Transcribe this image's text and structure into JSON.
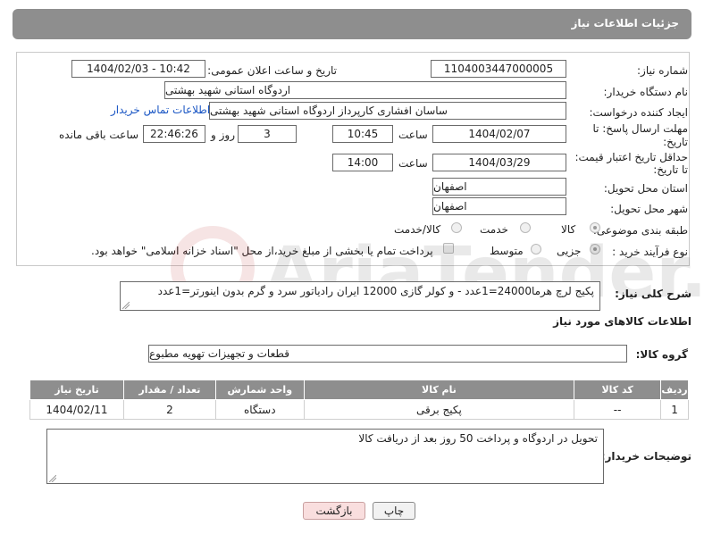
{
  "header": {
    "title": "جزئیات اطلاعات نیاز"
  },
  "form": {
    "need_number": {
      "label": "شماره نیاز:",
      "value": "1104003447000005"
    },
    "announce": {
      "label": "تاریخ و ساعت اعلان عمومی:",
      "value": "1404/02/03 - 10:42"
    },
    "buyer": {
      "label": "نام دستگاه خریدار:",
      "value": "اردوگاه استانی شهید بهشتی"
    },
    "creator": {
      "label": "ایجاد کننده درخواست:",
      "value": "ساسان  افشاری کارپرداز اردوگاه استانی شهید بهشتی",
      "contact_link": "اطلاعات تماس خریدار"
    },
    "deadline": {
      "label_line1": "مهلت ارسال پاسخ: تا",
      "label_line2": "تاریخ:",
      "date": "1404/02/07",
      "time_label": "ساعت",
      "time": "10:45",
      "days": "3",
      "days_label": "روز و",
      "remaining": "22:46:26",
      "remaining_label": "ساعت باقی مانده"
    },
    "price_validity": {
      "label_line1": "حداقل تاریخ اعتبار قیمت:",
      "label_line2": "تا تاریخ:",
      "date": "1404/03/29",
      "time_label": "ساعت",
      "time": "14:00"
    },
    "province": {
      "label": "استان محل تحویل:",
      "value": "اصفهان"
    },
    "city": {
      "label": "شهر محل تحویل:",
      "value": "اصفهان"
    },
    "category": {
      "label": "طبقه بندی موضوعی:",
      "options": [
        "کالا",
        "خدمت",
        "کالا/خدمت"
      ],
      "selected": "کالا"
    },
    "purchase_type": {
      "label": "نوع فرآیند خرید :",
      "options": [
        "جزیی",
        "متوسط"
      ],
      "selected": "جزیی",
      "payment_note": "پرداخت تمام یا بخشی از مبلغ خرید،از محل \"اسناد خزانه اسلامی\" خواهد بود."
    }
  },
  "summary": {
    "label": "شرح کلی نیاز:",
    "value": "پکیج لرچ هرما24000=1عدد - و کولر گازی 12000 ایران رادیاتور سرد و گرم بدون اینورتر=1عدد"
  },
  "goods_section": {
    "title": "اطلاعات کالاهای مورد نیاز"
  },
  "goods_group": {
    "label": "گروه کالا:",
    "value": "قطعات و تجهیزات تهویه مطبوع"
  },
  "table": {
    "headers": [
      "ردیف",
      "کد کالا",
      "نام کالا",
      "واحد شمارش",
      "تعداد / مقدار",
      "تاریخ نیاز"
    ],
    "rows": [
      [
        "1",
        "--",
        "پکیج برقی",
        "دستگاه",
        "2",
        "1404/02/11"
      ]
    ]
  },
  "buyer_notes": {
    "label": "توضیحات خریدار:",
    "value": "تحویل در اردوگاه و پرداخت 50 روز بعد از دریافت کالا"
  },
  "buttons": {
    "print": "چاپ",
    "back": "بازگشت"
  },
  "watermark": {
    "text": "AriaTender.neT"
  }
}
